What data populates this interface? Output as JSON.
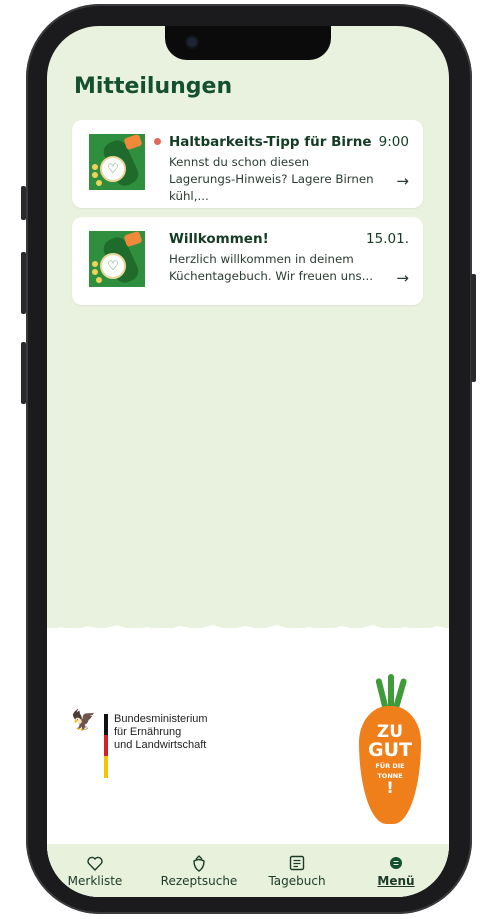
{
  "screen": {
    "title": "Mitteilungen"
  },
  "notifications": [
    {
      "title": "Haltbarkeits-Tipp für Birne",
      "time": "9:00",
      "body": "Kennst du schon diesen Lagerungs-Hinweis?  Lagere Birnen kühl,...",
      "unread": true
    },
    {
      "title": "Willkommen!",
      "time": "15.01.",
      "body": "Herzlich willkommen in deinem Küchentagebuch. Wir freuen uns...",
      "unread": false
    }
  ],
  "ministry": {
    "line1": "Bundesministerium",
    "line2": "für Ernährung",
    "line3": "und Landwirtschaft"
  },
  "campaign_logo": {
    "line1": "ZU",
    "line2": "GUT",
    "line3": "FÜR DIE",
    "line4": "TONNE",
    "line5": "!"
  },
  "tabbar": {
    "items": [
      {
        "label": "Merkliste",
        "icon": "heart-icon"
      },
      {
        "label": "Rezeptsuche",
        "icon": "strawberry-icon"
      },
      {
        "label": "Tagebuch",
        "icon": "journal-icon"
      },
      {
        "label": "Menü",
        "icon": "menu-dot-icon",
        "active": true
      }
    ]
  },
  "colors": {
    "background": "#e9f2de",
    "title": "#14502f",
    "accent_orange": "#ef7f1a",
    "unread_dot": "#e3675b",
    "thumb_green": "#2f8f3e"
  }
}
